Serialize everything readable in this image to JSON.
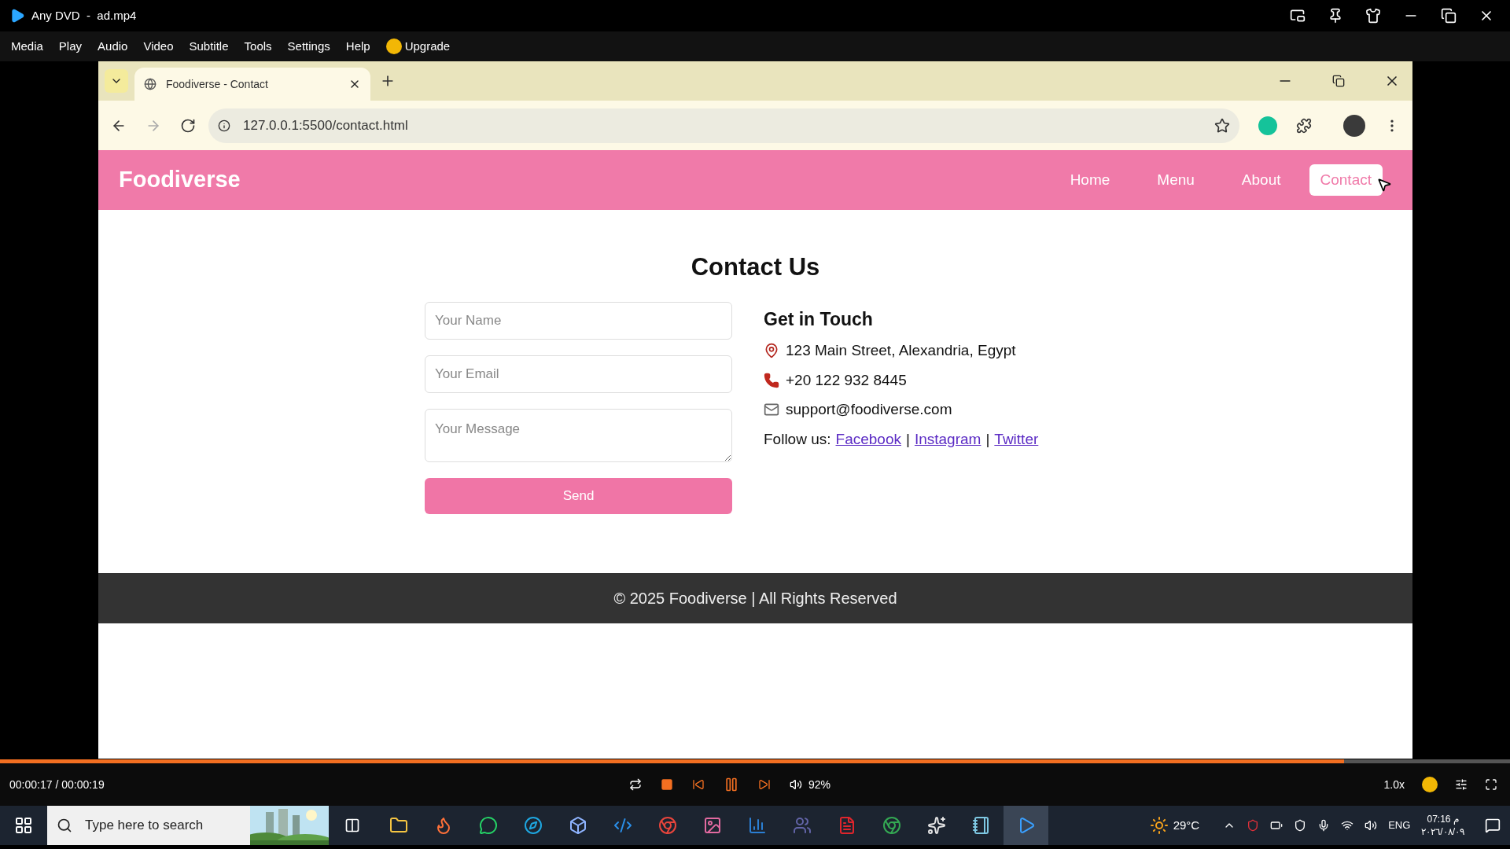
{
  "player": {
    "title": "Any DVD  -  ad.mp4",
    "menu": [
      "Media",
      "Play",
      "Audio",
      "Video",
      "Subtitle",
      "Tools",
      "Settings",
      "Help"
    ],
    "upgrade": "Upgrade"
  },
  "browser": {
    "tab_title": "Foodiverse - Contact",
    "url": "127.0.0.1:5500/contact.html"
  },
  "site": {
    "brand": "Foodiverse",
    "nav": [
      {
        "label": "Home",
        "selected": false
      },
      {
        "label": "Menu",
        "selected": false
      },
      {
        "label": "About",
        "selected": false
      },
      {
        "label": "Contact",
        "selected": true
      }
    ],
    "heading": "Contact Us",
    "fields": [
      {
        "kind": "input",
        "placeholder": "Your Name"
      },
      {
        "kind": "input",
        "placeholder": "Your Email"
      },
      {
        "kind": "textarea",
        "placeholder": "Your Message"
      }
    ],
    "submit": "Send",
    "info_heading": "Get in Touch",
    "info": [
      {
        "kind": "address",
        "text": "123 Main Street, Alexandria, Egypt"
      },
      {
        "kind": "phone",
        "text": "+20 122 932 8445"
      },
      {
        "kind": "email",
        "text": "support@foodiverse.com"
      }
    ],
    "follow": {
      "label": "Follow us:",
      "separator": "|",
      "links": [
        "Facebook",
        "Instagram",
        "Twitter"
      ]
    },
    "footer": "© 2025 Foodiverse | All Rights Reserved"
  },
  "playback": {
    "time": "00:00:17 / 00:00:19",
    "level": 0.89,
    "volume": "92%",
    "speed": "1.0x"
  },
  "taskbar": {
    "search_placeholder": "Type here to search",
    "weather": "29°C",
    "language": "ENG",
    "time": "07:16 م",
    "date": "٢٠٢٦/٠٨/٠٩"
  }
}
